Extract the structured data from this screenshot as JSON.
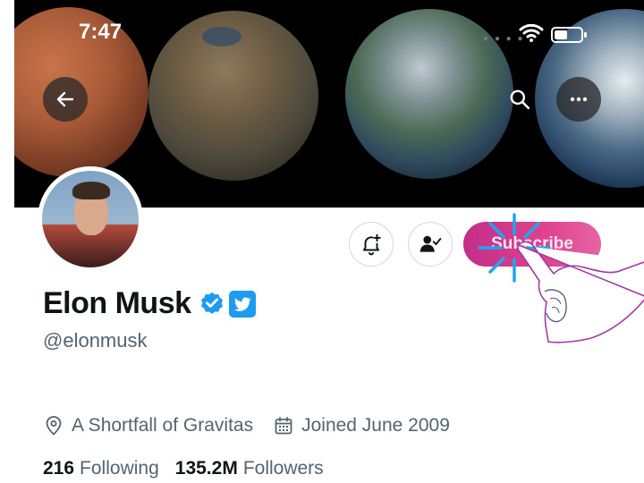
{
  "status_bar": {
    "time": "7:47"
  },
  "header": {
    "icons": [
      "back-arrow-icon",
      "search-icon",
      "more-icon"
    ]
  },
  "profile": {
    "display_name": "Elon Musk",
    "handle": "@elonmusk",
    "location": "A Shortfall of Gravitas",
    "joined": "Joined June 2009",
    "following_count": "216",
    "following_label": "Following",
    "followers_count": "135.2M",
    "followers_label": "Followers"
  },
  "actions": {
    "subscribe_label": "Subscribe",
    "icons": [
      "bell-plus-icon",
      "person-check-icon"
    ]
  },
  "colors": {
    "subscribe_bg": "#d0368c",
    "verified_blue": "#1d9bf0",
    "tap_indicator": "#1ea7f0",
    "hand_outline": "#a03aa8"
  }
}
